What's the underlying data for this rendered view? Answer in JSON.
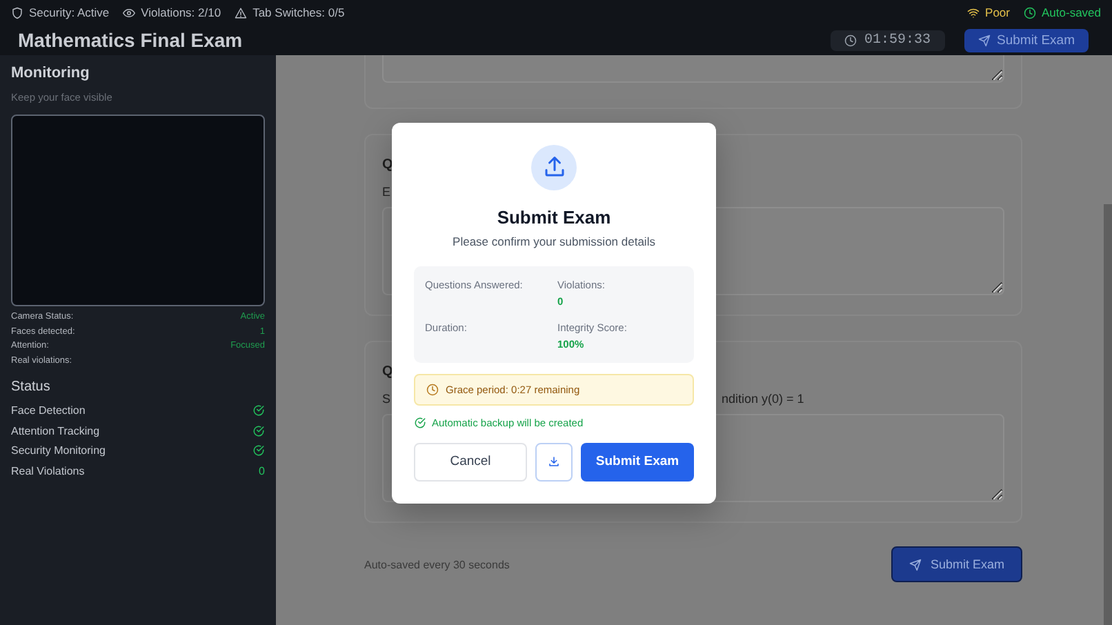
{
  "status_bar": {
    "items": [
      {
        "kind": "shield",
        "text": "Security: Active"
      },
      {
        "kind": "eye",
        "text": "Violations: 2/10"
      },
      {
        "kind": "warning",
        "text": "Tab Switches: 0/5"
      }
    ],
    "connection": "Poor",
    "autosave": "Auto-saved"
  },
  "header": {
    "title": "Mathematics Final Exam",
    "timer": "01:59:33",
    "submit_button": "Submit Exam"
  },
  "sidebar": {
    "title": "Monitoring",
    "subtitle": "Keep your face visible",
    "camera_stats": [
      {
        "label": "Camera Status:",
        "value": "Active"
      },
      {
        "label": "Faces detected:",
        "value": "1"
      },
      {
        "label": "Attention:",
        "value": "Focused"
      },
      {
        "label": "Real violations:"
      }
    ],
    "status_title": "Status",
    "status_items": [
      {
        "kind": "check",
        "label": "Face Detection",
        "checked": true
      },
      {
        "kind": "check",
        "label": "Attention Tracking",
        "checked": true
      },
      {
        "kind": "check",
        "label": "Security Monitoring",
        "checked": true
      },
      {
        "kind": "count",
        "label": "Real Violations",
        "value": "0"
      }
    ]
  },
  "main": {
    "cards": [
      {
        "title": "Q",
        "prompt": "E"
      },
      {
        "title": "Q",
        "prompt": "S",
        "prompt_tail": "ndition y(0) = 1"
      }
    ],
    "footer_note": "Auto-saved every 30 seconds",
    "submit_button": "Submit Exam"
  },
  "modal": {
    "title": "Submit Exam",
    "subtitle": "Please confirm your submission details",
    "details": [
      {
        "label": "Questions Answered:"
      },
      {
        "label": "Violations:",
        "value": "0"
      },
      {
        "label": "Duration:"
      },
      {
        "label": "Integrity Score:",
        "value": "100%"
      }
    ],
    "grace": "Grace period: 0:27 remaining",
    "backup": "Automatic backup will be created",
    "cancel": "Cancel",
    "submit": "Submit Exam"
  }
}
